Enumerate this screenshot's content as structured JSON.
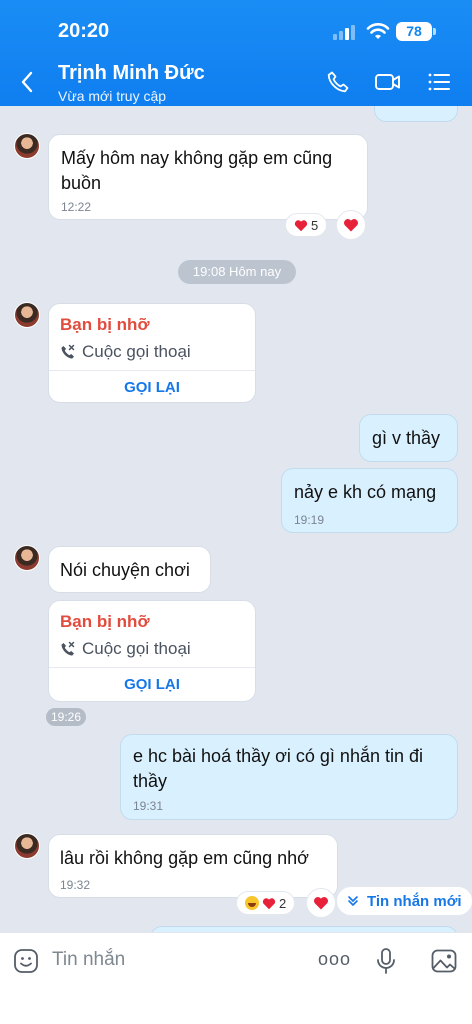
{
  "status_bar": {
    "time": "20:20",
    "battery": "78"
  },
  "header": {
    "contact_name": "Trịnh Minh Đức",
    "contact_status": "Vừa mới truy cập",
    "icons": [
      "back-icon",
      "phone-icon",
      "video-call-icon",
      "menu-icon"
    ]
  },
  "messages": [
    {
      "from": "contact",
      "text": "Mấy hôm nay không gặp em cũng buồn",
      "time": "12:22",
      "reaction_count": "5"
    },
    {
      "divider": "19:08 Hôm nay"
    },
    {
      "from": "contact",
      "type": "missed_call",
      "title": "Bạn bị nhỡ",
      "subtitle": "Cuộc gọi thoại",
      "action": "GỌI LẠI"
    },
    {
      "from": "me",
      "text": "gì v thầy"
    },
    {
      "from": "me",
      "text": "nảy e kh có mạng",
      "time": "19:19"
    },
    {
      "from": "contact",
      "text": "Nói chuyện chơi"
    },
    {
      "from": "contact",
      "type": "missed_call",
      "title": "Bạn bị nhỡ",
      "subtitle": "Cuộc gọi thoại",
      "action": "GỌI LẠI",
      "time": "19:26"
    },
    {
      "from": "me",
      "text": "e hc bài hoá thầy ơi có gì nhắn tin đi thầy",
      "time": "19:31"
    },
    {
      "from": "contact",
      "text": "lâu rồi không gặp em cũng nhớ",
      "time": "19:32",
      "reaction_count": "2"
    }
  ],
  "new_messages_label": "Tin nhắn mới",
  "composer": {
    "placeholder": "Tin nhắn",
    "more_label": "ooo"
  },
  "colors": {
    "header": "#1185f1",
    "outgoing_bubble": "#d9f0ff",
    "missed_call": "#e24c3f",
    "link": "#1677e8",
    "heart": "#e8213a"
  }
}
